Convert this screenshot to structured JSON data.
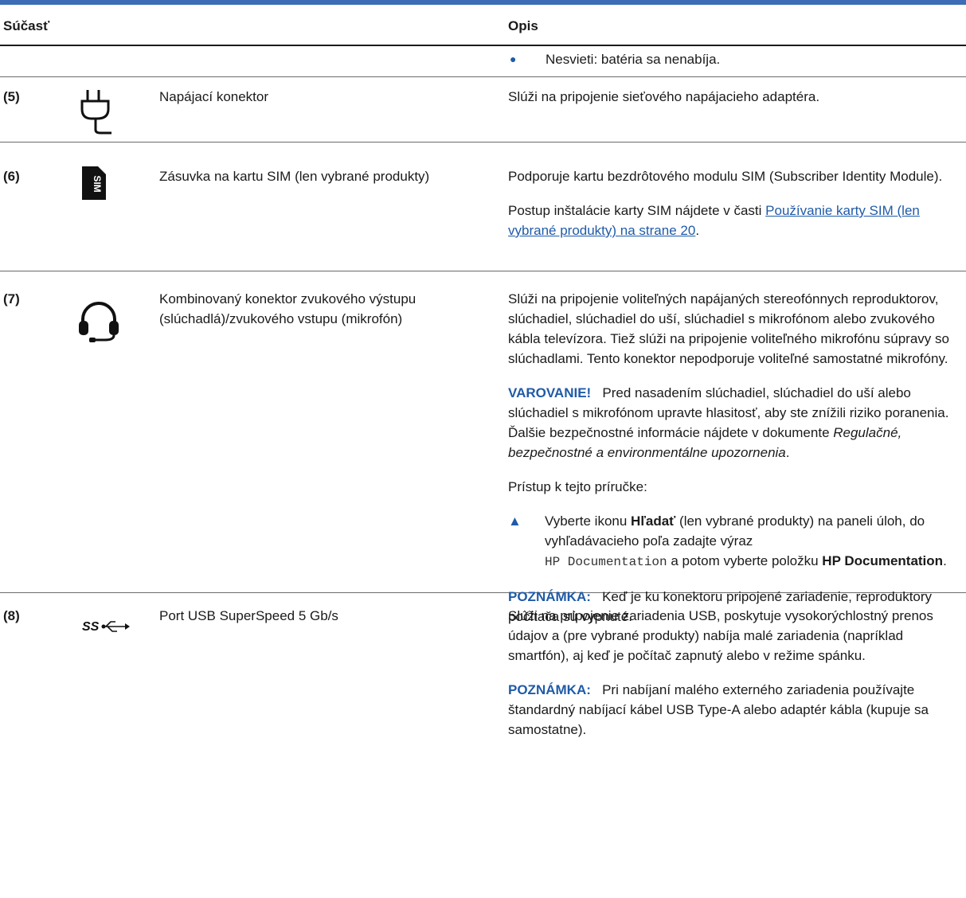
{
  "header": {
    "col_component": "Súčasť",
    "col_description": "Opis"
  },
  "continued": {
    "bullet_text": "Nesvieti: batéria sa nenabíja."
  },
  "rows": [
    {
      "num": "(5)",
      "icon": "power-plug-icon",
      "name": "Napájací konektor",
      "desc": [
        "Slúži na pripojenie sieťového napájacieho adaptéra."
      ]
    },
    {
      "num": "(6)",
      "icon": "sim-card-icon",
      "icon_text": "SIM",
      "name": "Zásuvka na kartu SIM (len vybrané produkty)",
      "desc": [
        "Podporuje kartu bezdrôtového modulu SIM (Subscriber Identity Module).",
        "Postup inštalácie karty SIM nájdete v časti ",
        "Používanie karty SIM (len vybrané produkty) na strane 20",
        "."
      ]
    },
    {
      "num": "(7)",
      "icon": "headset-icon",
      "name": "Kombinovaný konektor zvukového výstupu (slúchadlá)/zvukového vstupu (mikrofón)",
      "desc_1": "Slúži na pripojenie voliteľných napájaných stereofónnych reproduktorov, slúchadiel, slúchadiel do uší, slúchadiel s mikrofónom alebo zvukového kábla televízora. Tiež slúži na pripojenie voliteľného mikrofónu súpravy so slúchadlami. Tento konektor nepodporuje voliteľné samostatné mikrofóny.",
      "warning_label": "VAROVANIE!",
      "warning_text": "Pred nasadením slúchadiel, slúchadiel do uší alebo slúchadiel s mikrofónom upravte hlasitosť, aby ste znížili riziko poranenia. Ďalšie bezpečnostné informácie nájdete v dokumente ",
      "warning_doc": "Regulačné, bezpečnostné a environmentálne upozornenia",
      "warning_end": ".",
      "access": "Prístup k tejto príručke:",
      "step_a": "Vyberte ikonu ",
      "step_b": "Hľadať",
      "step_c": " (len vybrané produkty) na paneli úloh, do vyhľadávacieho poľa zadajte výraz",
      "step_code": "HP Documentation",
      "step_d": " a potom vyberte položku ",
      "step_e": "HP Documentation",
      "step_f": ".",
      "note_label": "POZNÁMKA:",
      "note_text": "Keď je ku konektoru pripojené zariadenie, reproduktory počítača sú vypnuté."
    },
    {
      "num": "(8)",
      "icon": "usb-superspeed-icon",
      "icon_text": "SS",
      "name": "Port USB SuperSpeed 5 Gb/s",
      "desc_1": "Slúži na pripojenie zariadenia USB, poskytuje vysokorýchlostný prenos údajov a (pre vybrané produkty) nabíja malé zariadenia (napríklad smartfón), aj keď je počítač zapnutý alebo v režime spánku.",
      "note_label": "POZNÁMKA:",
      "note_text": "Pri nabíjaní malého externého zariadenia používajte štandardný nabíjací kábel USB Type-A alebo adaptér kábla (kupuje sa samostatne)."
    }
  ]
}
